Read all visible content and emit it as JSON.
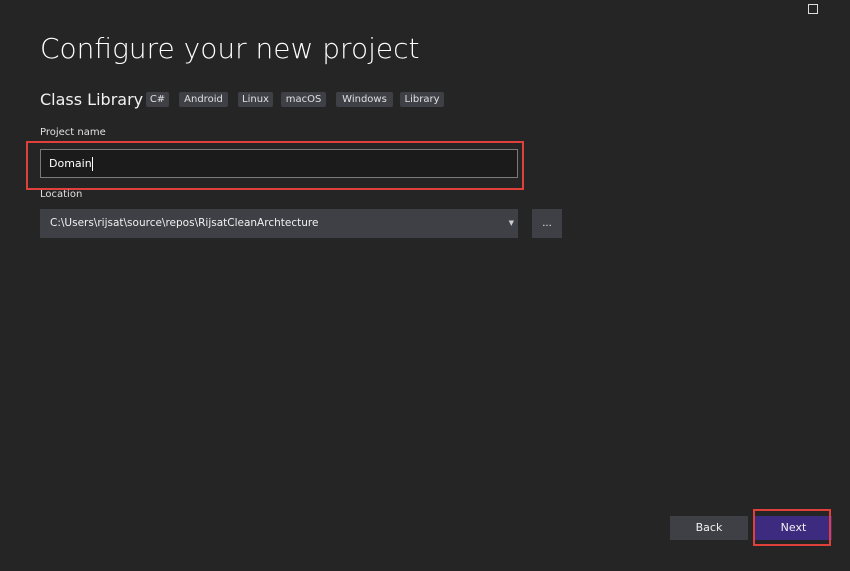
{
  "window": {
    "restore_icon": "restore-icon"
  },
  "title": "Configure your new project",
  "template": {
    "name": "Class Library",
    "tags": [
      "C#",
      "Android",
      "Linux",
      "macOS",
      "Windows",
      "Library"
    ]
  },
  "project_name": {
    "label": "Project name",
    "value": "Domain"
  },
  "location": {
    "label": "Location",
    "value": "C:\\Users\\rijsat\\source\\repos\\RijsatCleanArchtecture",
    "browse_label": "..."
  },
  "buttons": {
    "back": "Back",
    "next": "Next"
  },
  "colors": {
    "accent": "#3d2b7f",
    "highlight": "#e0403c"
  }
}
